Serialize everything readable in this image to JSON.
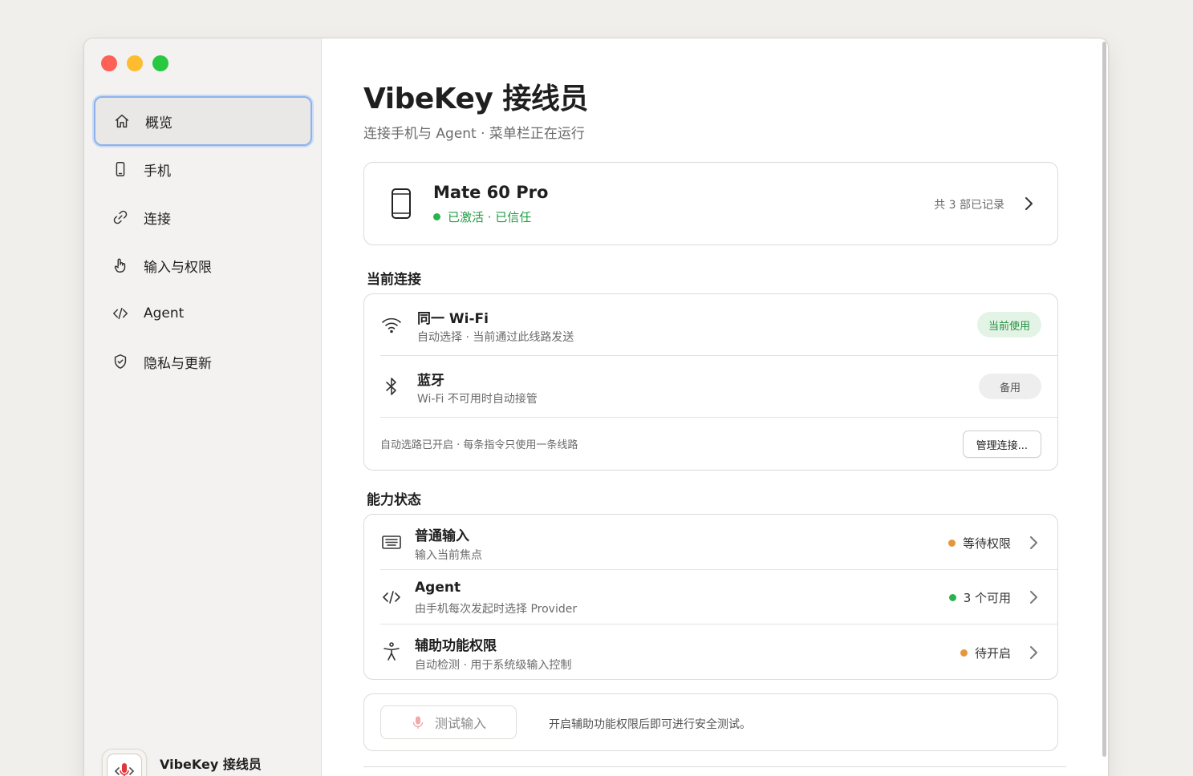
{
  "window": {
    "app_name": "VibeKey 接线员"
  },
  "sidebar": {
    "items": [
      {
        "label": "概览",
        "icon": "home-icon",
        "active": true
      },
      {
        "label": "手机",
        "icon": "phone-icon",
        "active": false
      },
      {
        "label": "连接",
        "icon": "link-icon",
        "active": false
      },
      {
        "label": "输入与权限",
        "icon": "hand-pointer-icon",
        "active": false
      },
      {
        "label": "Agent",
        "icon": "code-icon",
        "active": false
      },
      {
        "label": "隐私与更新",
        "icon": "shield-check-icon",
        "active": false
      }
    ]
  },
  "header": {
    "title": "VibeKey 接线员",
    "subtitle": "连接手机与 Agent · 菜单栏正在运行"
  },
  "device": {
    "name": "Mate 60 Pro",
    "status": "已激活 · 已信任",
    "count": "共 3 部已记录"
  },
  "connections": {
    "heading": "当前连接",
    "items": [
      {
        "title": "同一 Wi-Fi",
        "subtitle": "自动选择 · 当前通过此线路发送",
        "badge": "当前使用",
        "icon": "wifi-icon"
      },
      {
        "title": "蓝牙",
        "subtitle": "Wi-Fi 不可用时自动接管",
        "badge": "备用",
        "icon": "bluetooth-icon"
      }
    ],
    "footer": "自动选路已开启 · 每条指令只使用一条线路",
    "manage_label": "管理连接..."
  },
  "capabilities": {
    "heading": "能力状态",
    "items": [
      {
        "title": "普通输入",
        "subtitle": "输入当前焦点",
        "status": "等待权限",
        "status_color": "#e5963a",
        "icon": "keyboard-icon"
      },
      {
        "title": "Agent",
        "subtitle": "由手机每次发起时选择 Provider",
        "status": "3 个可用",
        "status_color": "#29b34f",
        "icon": "code-icon"
      },
      {
        "title": "辅助功能权限",
        "subtitle": "自动检测 · 用于系统级输入控制",
        "status": "待开启",
        "status_color": "#e5963a",
        "icon": "accessibility-icon"
      }
    ]
  },
  "test": {
    "button_label": "测试输入",
    "hint": "开启辅助功能权限后即可进行安全测试。"
  },
  "colors": {
    "accent": "#8fb2ea",
    "success": "#29b34f",
    "warning": "#e5963a"
  }
}
